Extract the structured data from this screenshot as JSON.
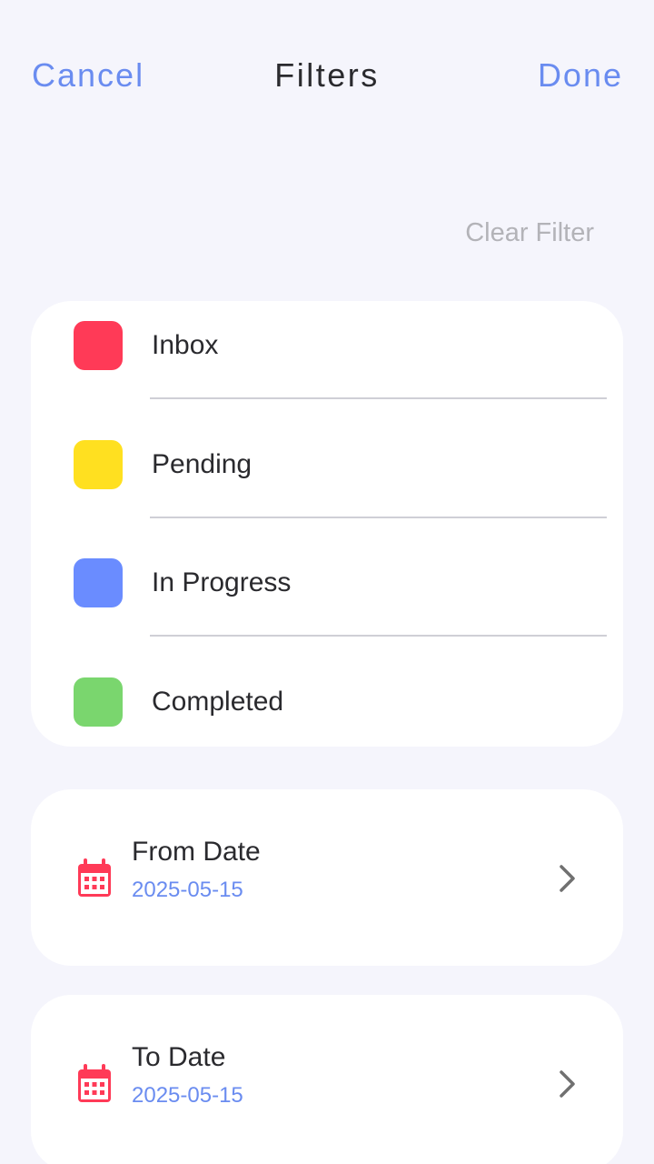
{
  "header": {
    "cancel_label": "Cancel",
    "title": "Filters",
    "done_label": "Done"
  },
  "clear_filter_label": "Clear Filter",
  "statuses": [
    {
      "label": "Inbox",
      "color": "#ff3a57"
    },
    {
      "label": "Pending",
      "color": "#ffe020"
    },
    {
      "label": "In Progress",
      "color": "#6a8cff"
    },
    {
      "label": "Completed",
      "color": "#7ad66e"
    }
  ],
  "from_date": {
    "label": "From Date",
    "value": "2025-05-15",
    "icon": "calendar-icon"
  },
  "to_date": {
    "label": "To Date",
    "value": "2025-05-15",
    "icon": "calendar-icon"
  },
  "colors": {
    "accent": "#6a8cf0",
    "calendar_icon": "#ff3a57",
    "background": "#f5f5fc"
  }
}
